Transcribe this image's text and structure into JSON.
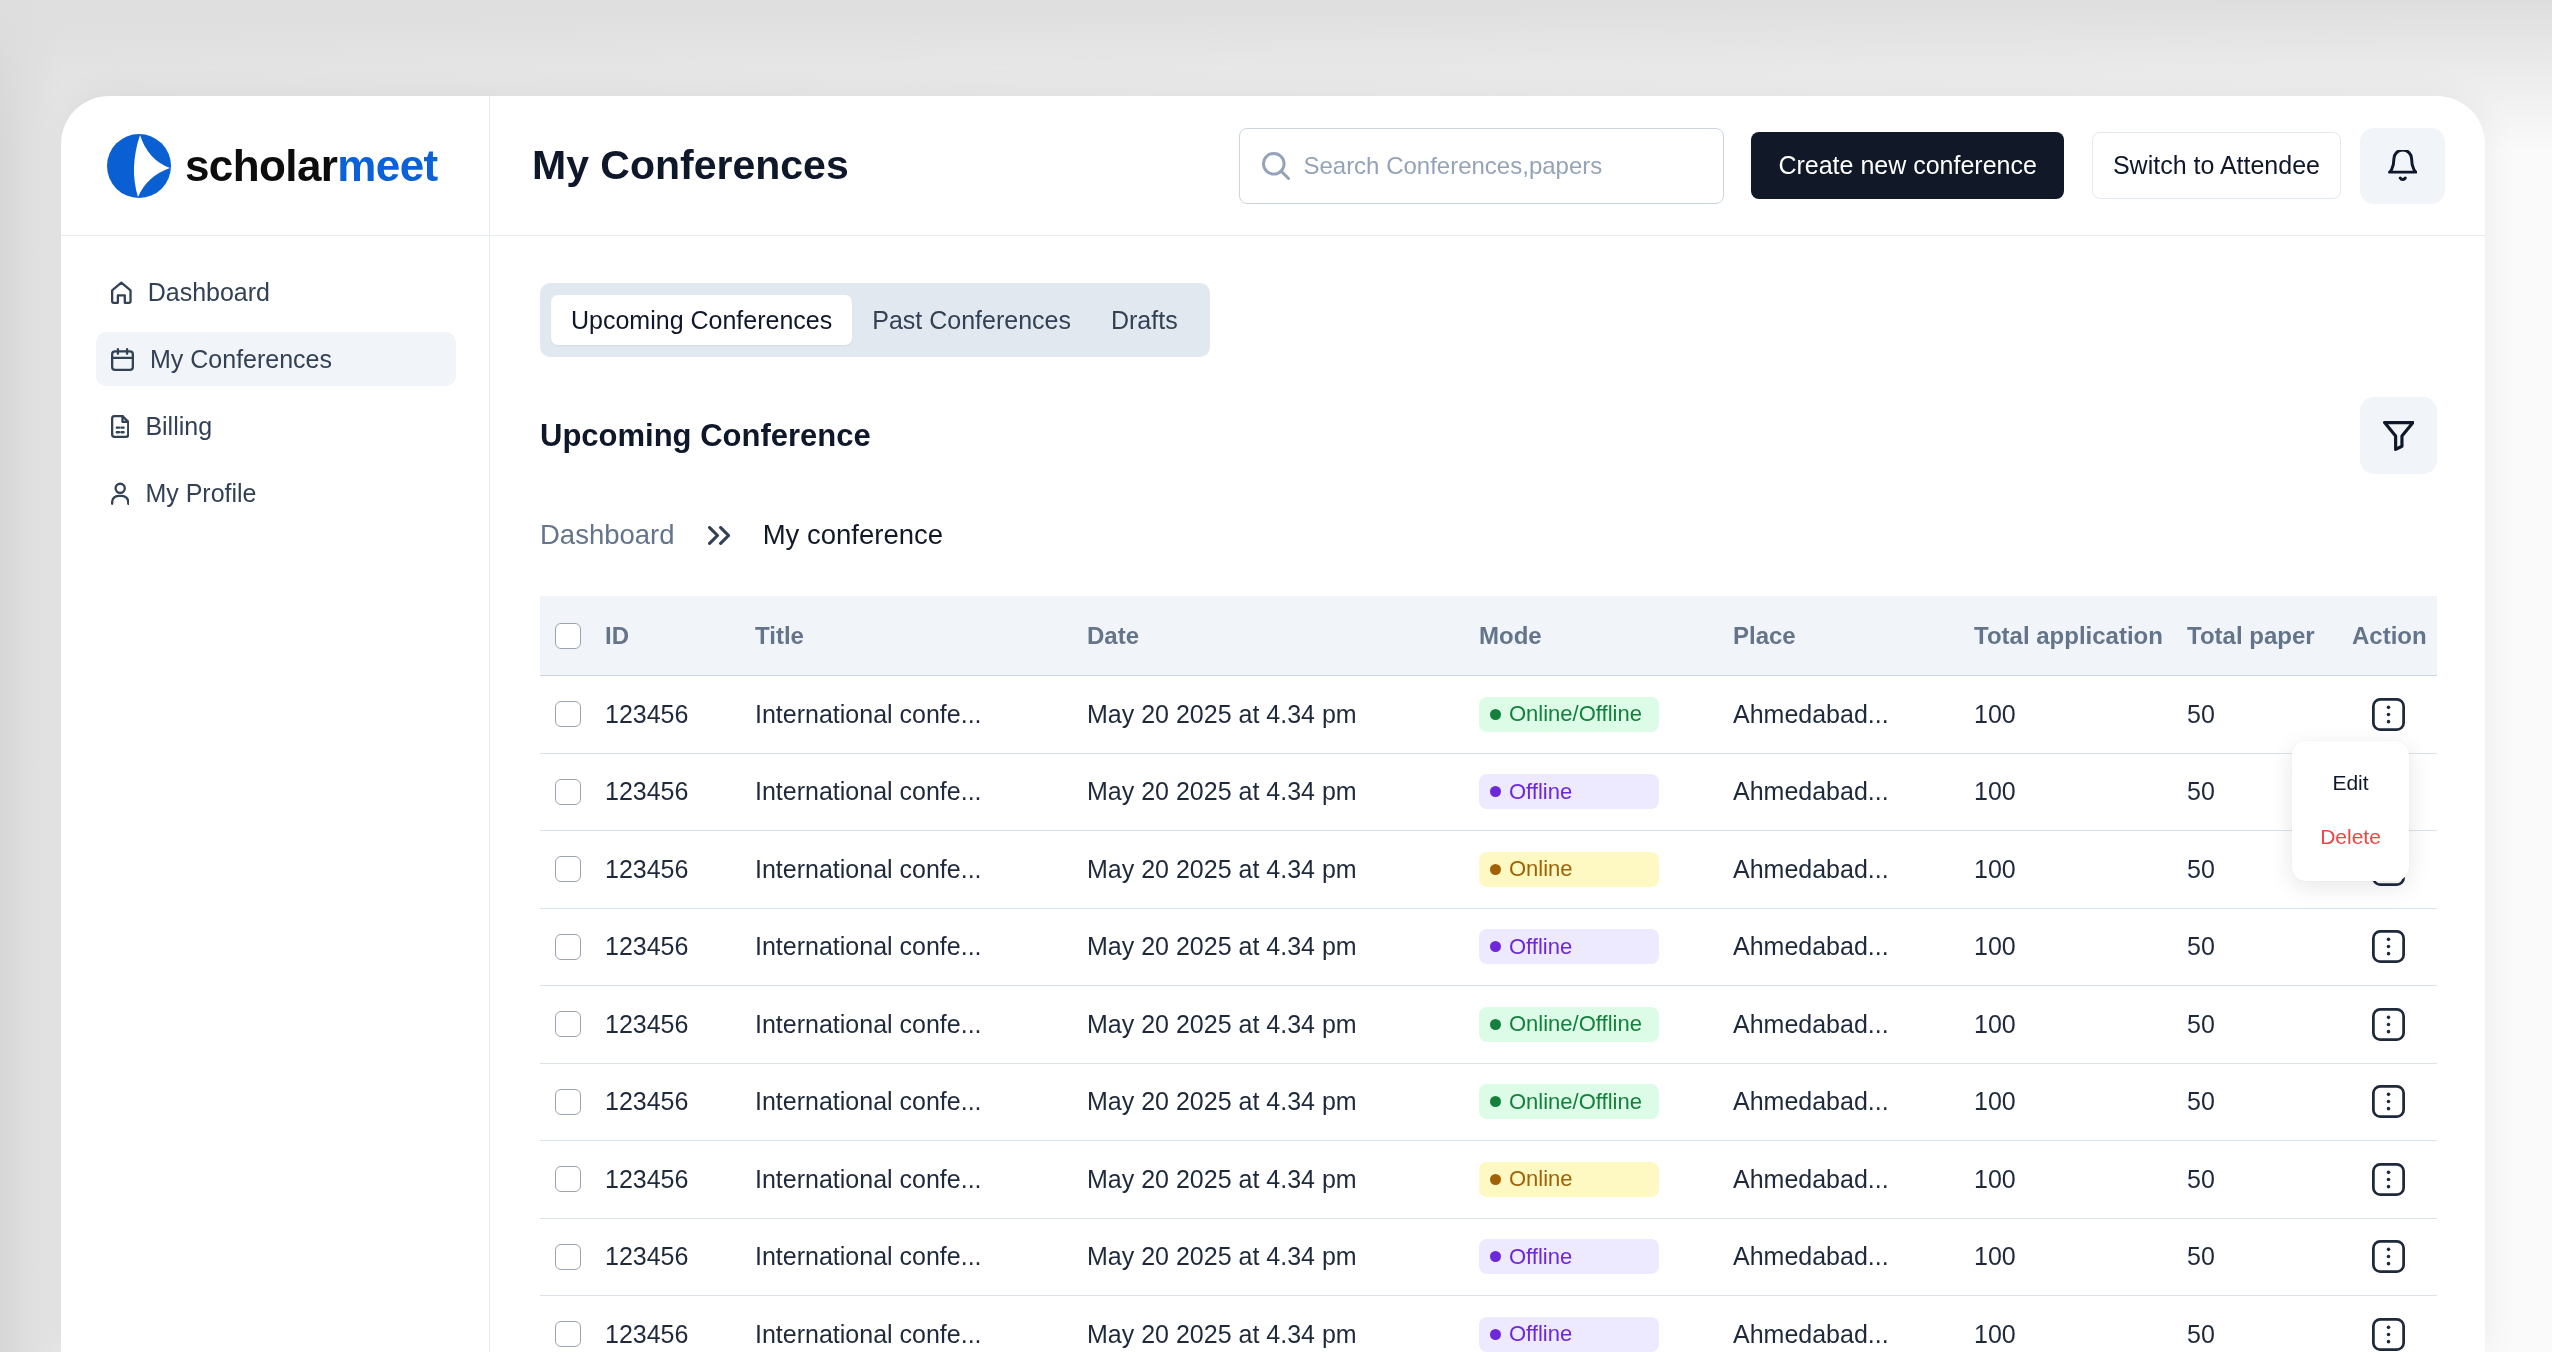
{
  "sidebar": {
    "logo": {
      "parts": [
        "scholar",
        "meet"
      ]
    },
    "items": [
      {
        "label": "Dashboard",
        "selected": false
      },
      {
        "label": "My Conferences",
        "selected": true
      },
      {
        "label": "Billing",
        "selected": false
      },
      {
        "label": "My Profile",
        "selected": false
      }
    ]
  },
  "header": {
    "title": "My Conferences",
    "search": {
      "placeholder": "Search Conferences,papers"
    },
    "buttons": [
      {
        "label": "Create new conference",
        "kind": "primary"
      },
      {
        "label": "Switch to Attendee",
        "kind": "secondary"
      }
    ]
  },
  "tabs": [
    {
      "label": "Upcoming Conferences",
      "selected": true
    },
    {
      "label": "Past Conferences",
      "selected": false
    },
    {
      "label": "Drafts",
      "selected": false
    }
  ],
  "section": {
    "title": "Upcoming Conference"
  },
  "breadcrumb": [
    {
      "label": "Dashboard",
      "current": false
    },
    {
      "label": "My conference",
      "current": true
    }
  ],
  "table": {
    "all_checked": false,
    "columns": [
      "ID",
      "Title",
      "Date",
      "Mode",
      "Place",
      "Total application",
      "Total paper",
      "Action"
    ],
    "rows": [
      {
        "checked": false,
        "id": "123456",
        "title": "International confe...",
        "date": "May 20 2025 at 4.34 pm",
        "mode": {
          "label": "Online/Offline",
          "color": "#15803d"
        },
        "place": "Ahmedabad...",
        "total_application": "100",
        "total_paper": "50"
      },
      {
        "checked": false,
        "id": "123456",
        "title": "International confe...",
        "date": "May 20 2025 at 4.34 pm",
        "mode": {
          "label": "Offline",
          "color": "#6d28d9"
        },
        "place": "Ahmedabad...",
        "total_application": "100",
        "total_paper": "50"
      },
      {
        "checked": false,
        "id": "123456",
        "title": "International confe...",
        "date": "May 20 2025 at 4.34 pm",
        "mode": {
          "label": "Online",
          "color": "#a16207"
        },
        "place": "Ahmedabad...",
        "total_application": "100",
        "total_paper": "50"
      },
      {
        "checked": false,
        "id": "123456",
        "title": "International confe...",
        "date": "May 20 2025 at 4.34 pm",
        "mode": {
          "label": "Offline",
          "color": "#6d28d9"
        },
        "place": "Ahmedabad...",
        "total_application": "100",
        "total_paper": "50"
      },
      {
        "checked": false,
        "id": "123456",
        "title": "International confe...",
        "date": "May 20 2025 at 4.34 pm",
        "mode": {
          "label": "Online/Offline",
          "color": "#15803d"
        },
        "place": "Ahmedabad...",
        "total_application": "100",
        "total_paper": "50"
      },
      {
        "checked": false,
        "id": "123456",
        "title": "International confe...",
        "date": "May 20 2025 at 4.34 pm",
        "mode": {
          "label": "Online/Offline",
          "color": "#15803d"
        },
        "place": "Ahmedabad...",
        "total_application": "100",
        "total_paper": "50"
      },
      {
        "checked": false,
        "id": "123456",
        "title": "International confe...",
        "date": "May 20 2025 at 4.34 pm",
        "mode": {
          "label": "Online",
          "color": "#a16207"
        },
        "place": "Ahmedabad...",
        "total_application": "100",
        "total_paper": "50"
      },
      {
        "checked": false,
        "id": "123456",
        "title": "International confe...",
        "date": "May 20 2025 at 4.34 pm",
        "mode": {
          "label": "Offline",
          "color": "#6d28d9"
        },
        "place": "Ahmedabad...",
        "total_application": "100",
        "total_paper": "50"
      },
      {
        "checked": false,
        "id": "123456",
        "title": "International confe...",
        "date": "May 20 2025 at 4.34 pm",
        "mode": {
          "label": "Offline",
          "color": "#6d28d9"
        },
        "place": "Ahmedabad...",
        "total_application": "100",
        "total_paper": "50"
      }
    ],
    "action_menu": {
      "open": true,
      "items": [
        {
          "label": "Edit",
          "kind": "normal"
        },
        {
          "label": "Delete",
          "kind": "danger"
        }
      ]
    }
  }
}
